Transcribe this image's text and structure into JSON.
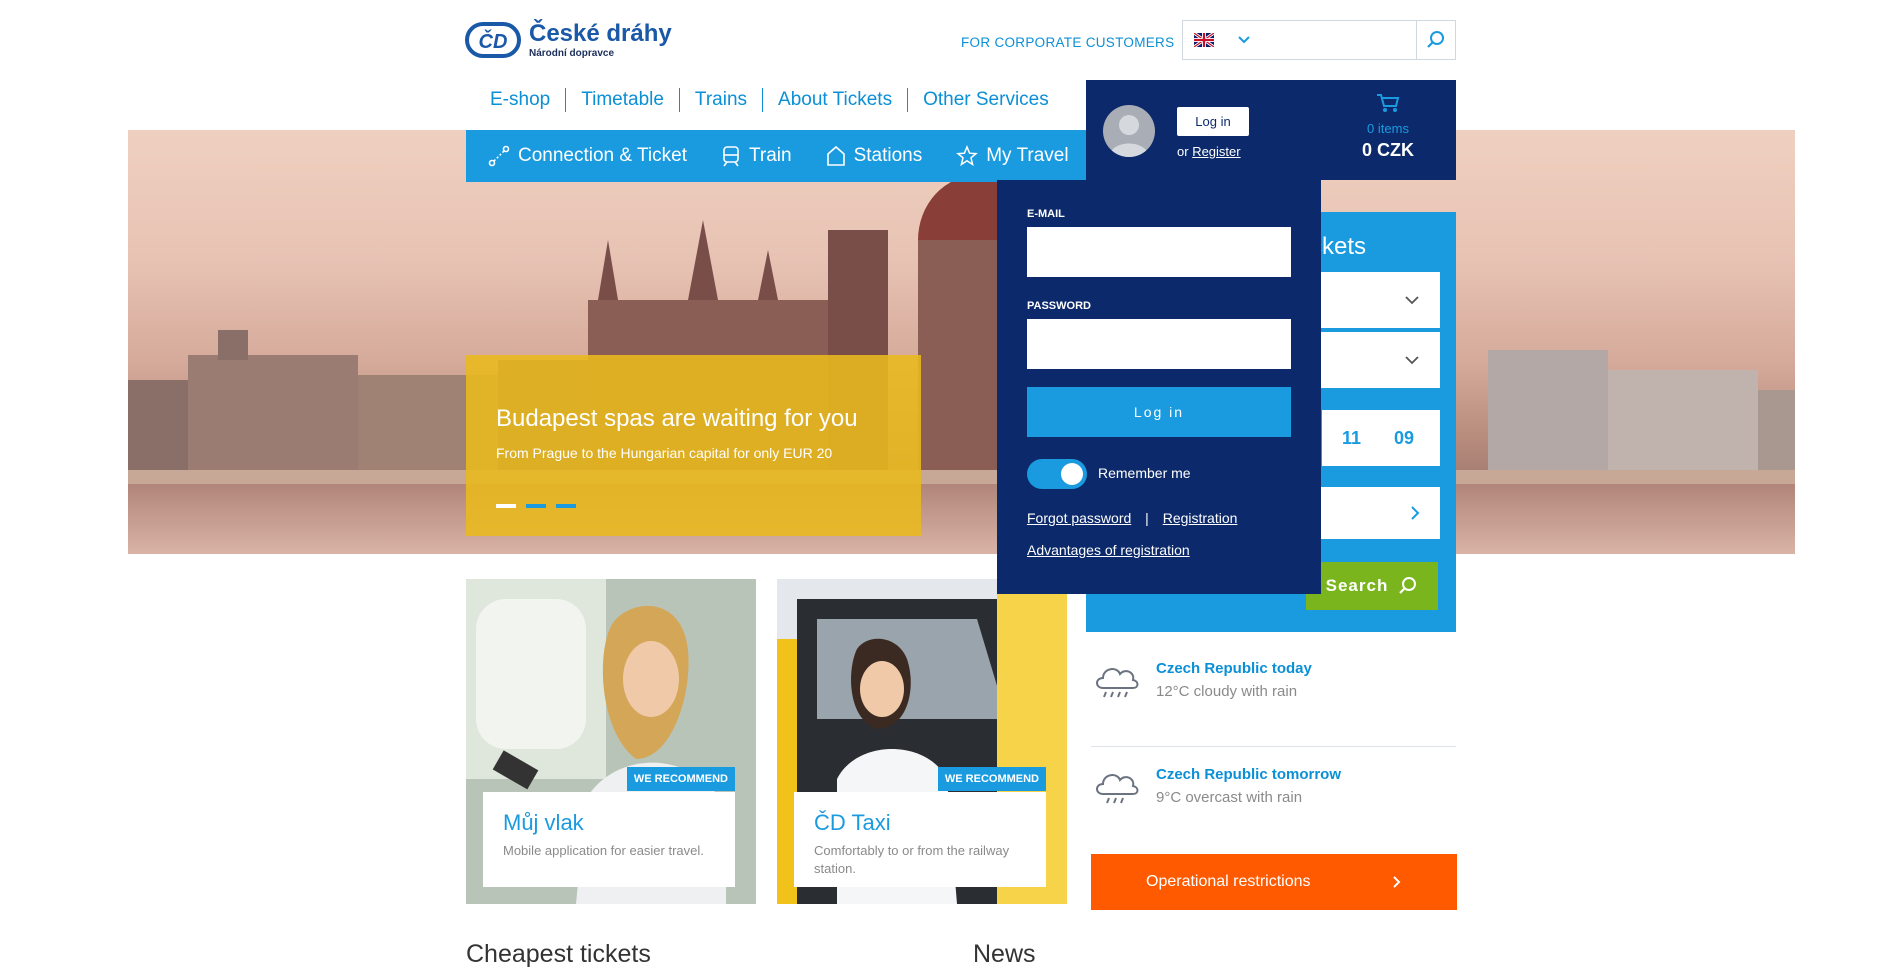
{
  "header": {
    "brand": {
      "name": "České dráhy",
      "tagline": "Národní dopravce"
    },
    "corporate_link": "FOR CORPORATE CUSTOMERS",
    "language": {
      "selected": "English"
    },
    "search": {
      "placeholder": ""
    }
  },
  "top_nav": [
    {
      "label": "E-shop"
    },
    {
      "label": "Timetable"
    },
    {
      "label": "Trains"
    },
    {
      "label": "About Tickets"
    },
    {
      "label": "Other Services"
    }
  ],
  "blue_nav": [
    {
      "label": "Connection & Ticket",
      "icon": "route-icon"
    },
    {
      "label": "Train",
      "icon": "train-icon"
    },
    {
      "label": "Stations",
      "icon": "station-icon"
    },
    {
      "label": "My Travel",
      "icon": "star-icon"
    }
  ],
  "hero": {
    "title": "Budapest spas are waiting for you",
    "subtitle": "From Prague to the Hungarian capital for only EUR 20",
    "slides": 3,
    "active_slide": 1
  },
  "cart": {
    "items": "0 items",
    "total": "0 CZK"
  },
  "tickets_panel": {
    "title_visible": "ckets",
    "time": {
      "hours": "11",
      "minutes": "09"
    },
    "search_button": "Search"
  },
  "login": {
    "login_button": "Log in",
    "or_text": "or",
    "register_link": "Register",
    "email_label": "E-MAIL",
    "password_label": "PASSWORD",
    "submit": "Log in",
    "remember_me": "Remember me",
    "remember_checked": true,
    "forgot_password": "Forgot password",
    "separator": "|",
    "registration": "Registration",
    "advantages": "Advantages of registration"
  },
  "weather": [
    {
      "title": "Czech Republic today",
      "desc": "12°C cloudy with rain",
      "icon": "cloud-rain-icon"
    },
    {
      "title": "Czech Republic tomorrow",
      "desc": "9°C overcast with rain",
      "icon": "cloud-rain-icon"
    }
  ],
  "operational": {
    "label": "Operational restrictions"
  },
  "cards": [
    {
      "badge": "WE RECOMMEND",
      "title": "Můj vlak",
      "desc": "Mobile application for easier travel."
    },
    {
      "badge": "WE RECOMMEND",
      "title": "ČD Taxi",
      "desc": "Comfortably to or from the railway station."
    }
  ],
  "sections": {
    "cheapest": "Cheapest tickets",
    "news": "News"
  },
  "colors": {
    "primary_blue": "#1a9be0",
    "navy": "#0c2a6b",
    "promo_yellow": "#e9b91d",
    "green": "#7ab51d",
    "orange": "#ff5a00"
  }
}
